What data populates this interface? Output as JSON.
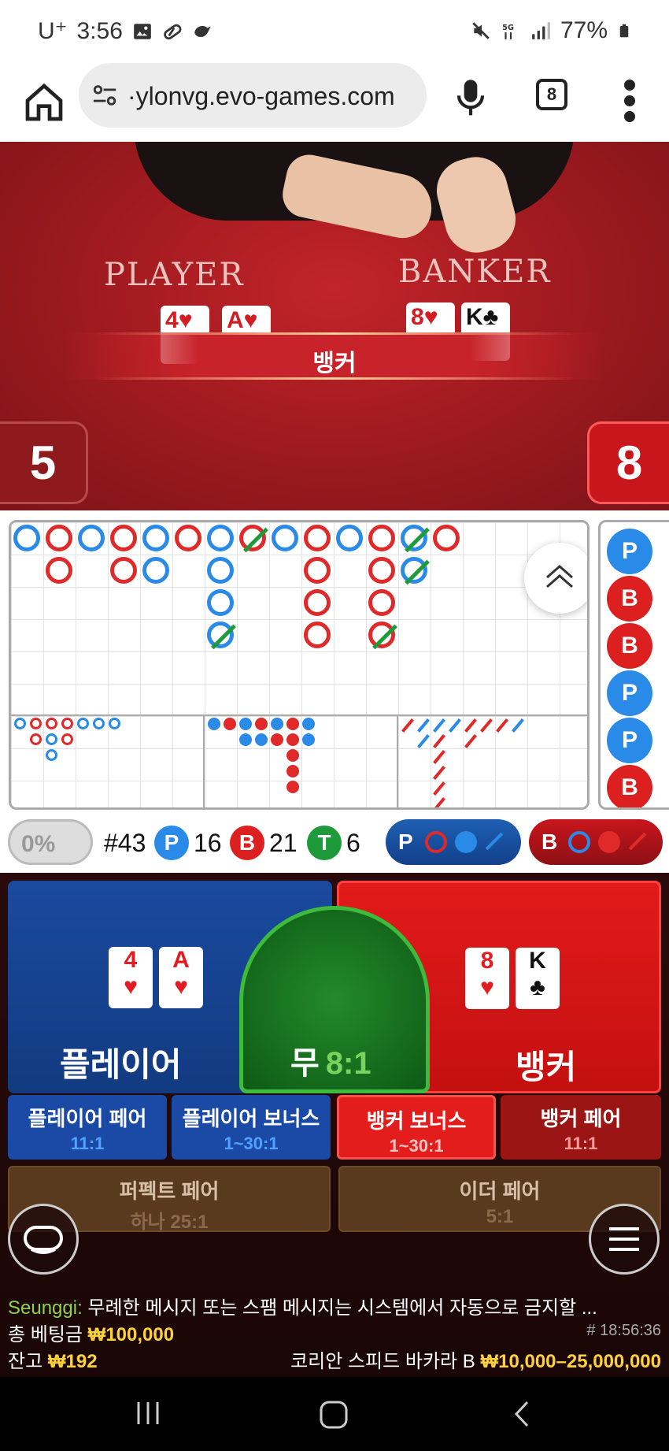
{
  "status_bar": {
    "carrier": "U⁺",
    "time": "3:56",
    "battery": "77%"
  },
  "browser": {
    "url": "·ylonvg.evo-games.com",
    "tab_count": "8"
  },
  "video": {
    "player_word": "PLAYER",
    "banker_word": "BANKER",
    "player_cards": [
      {
        "rank": "4",
        "suit": "♥",
        "color": "red"
      },
      {
        "rank": "A",
        "suit": "♥",
        "color": "red"
      }
    ],
    "banker_cards": [
      {
        "rank": "8",
        "suit": "♥",
        "color": "red"
      },
      {
        "rank": "K",
        "suit": "♣",
        "color": "black"
      }
    ],
    "result": "뱅커",
    "player_score": "5",
    "banker_score": "8"
  },
  "stats": {
    "percent": "0%",
    "round": "#43",
    "p_letter": "P",
    "p_count": "16",
    "b_letter": "B",
    "b_count": "21",
    "t_letter": "T",
    "t_count": "6",
    "p_predict": "P",
    "b_predict": "B"
  },
  "bead_road": [
    "P",
    "B",
    "B",
    "P",
    "P",
    "B"
  ],
  "bets": {
    "player": {
      "label": "플레이어",
      "cards": [
        {
          "rank": "4",
          "suit": "♥"
        },
        {
          "rank": "A",
          "suit": "♥"
        }
      ]
    },
    "tie": {
      "label": "무",
      "odds": "8:1"
    },
    "banker": {
      "label": "뱅커",
      "cards": [
        {
          "rank": "8",
          "suit": "♥",
          "color": "r"
        },
        {
          "rank": "K",
          "suit": "♣",
          "color": "k"
        }
      ]
    },
    "side": [
      {
        "name": "플레이어 페어",
        "odds": "11:1"
      },
      {
        "name": "플레이어 보너스",
        "odds": "1~30:1"
      },
      {
        "name": "뱅커 보너스",
        "odds": "1~30:1"
      },
      {
        "name": "뱅커 페어",
        "odds": "11:1"
      }
    ],
    "perfect_pair": {
      "name": "퍼펙트 페어",
      "odds": "하나 25:1"
    },
    "either_pair": {
      "name": "이더 페어",
      "odds": "5:1"
    }
  },
  "chat": {
    "user": "Seunggi:",
    "message": " 무례한 메시지 또는 스팸 메시지는 시스템에서 자동으로 금지할 ...",
    "timestamp": "# 18:56:36"
  },
  "footer": {
    "total_bet_label": "총 베팅금",
    "total_bet_value": "₩100,000",
    "balance_label": "잔고",
    "balance_value": "₩192",
    "table_name": "코리안 스피드 바카라 B",
    "limits": "₩10,000–25,000,000"
  },
  "colors": {
    "player_blue": "#2a8ae8",
    "banker_red": "#e02a2a",
    "tie_green": "#1e9a3a"
  }
}
